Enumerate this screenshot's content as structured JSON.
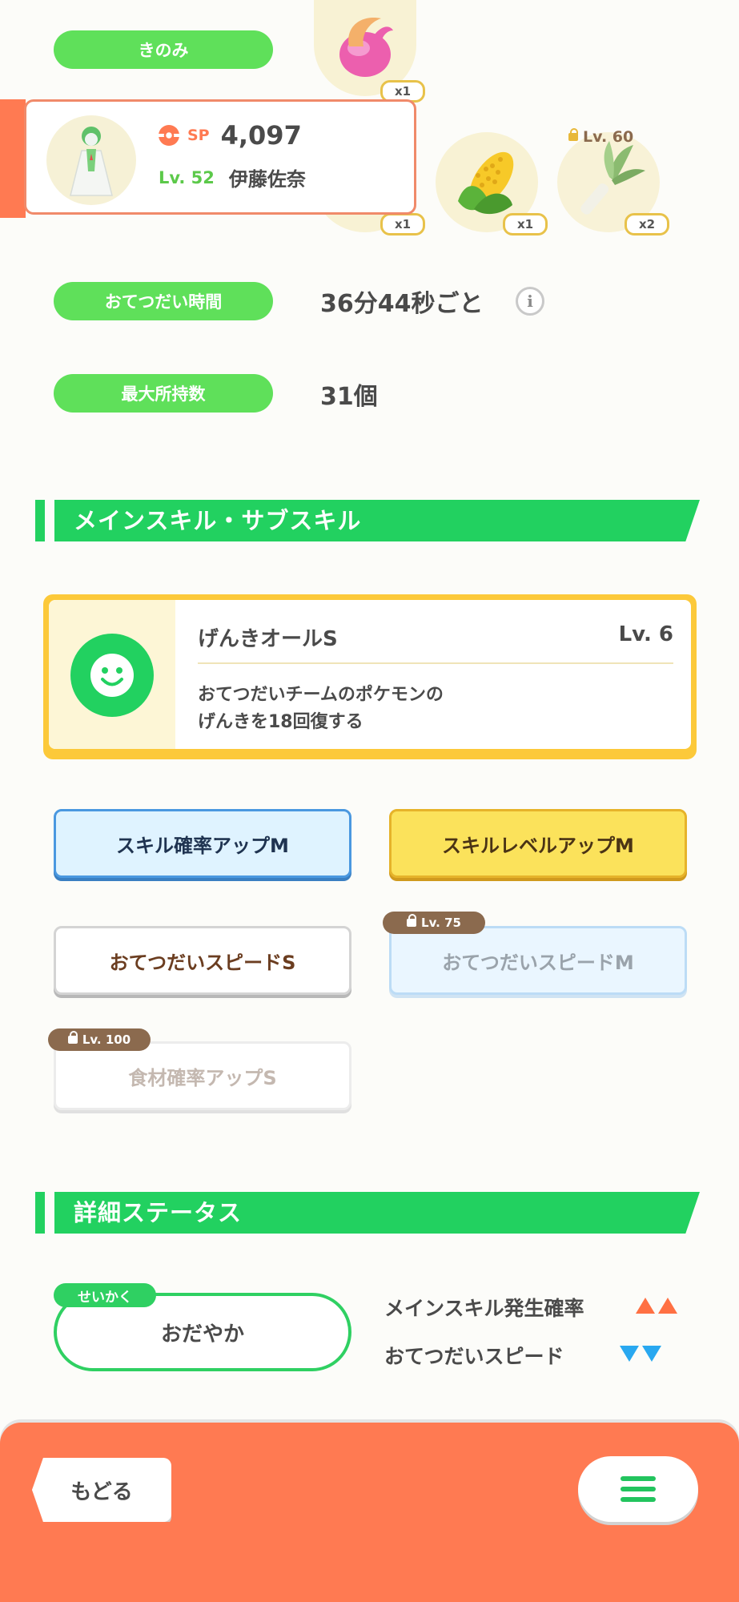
{
  "berry": {
    "label": "きのみ",
    "count": "x1"
  },
  "pokemon": {
    "sp_label": "SP",
    "sp_value": "4,097",
    "level": "Lv. 52",
    "nickname": "伊藤佐奈"
  },
  "ingredients": [
    {
      "count": "x1"
    },
    {
      "count": "x1"
    },
    {
      "count": "x2",
      "lock": "Lv. 60"
    }
  ],
  "help_time": {
    "label": "おてつだい時間",
    "value": "36分44秒ごと"
  },
  "max_carry": {
    "label": "最大所持数",
    "value": "31個"
  },
  "skills_section": {
    "title": "メインスキル・サブスキル"
  },
  "main_skill": {
    "name": "げんきオールS",
    "level": "Lv. 6",
    "desc_line1": "おてつだいチームのポケモンの",
    "desc_line2": "げんきを18回復する"
  },
  "sub_skills": [
    {
      "label": "スキル確率アップM"
    },
    {
      "label": "スキルレベルアップM"
    },
    {
      "label": "おてつだいスピードS"
    },
    {
      "label": "おてつだいスピードM",
      "lock": "Lv. 75"
    },
    {
      "label": "食材確率アップS",
      "lock": "Lv. 100"
    }
  ],
  "details_section": {
    "title": "詳細ステータス"
  },
  "nature": {
    "tag": "せいかく",
    "value": "おだやか",
    "up_label": "メインスキル発生確率",
    "down_label": "おてつだいスピード",
    "up_color": "#ff7043",
    "down_color": "#29a8f0"
  },
  "footer": {
    "back_label": "もどる",
    "menu_icon": "hamburger-icon"
  }
}
